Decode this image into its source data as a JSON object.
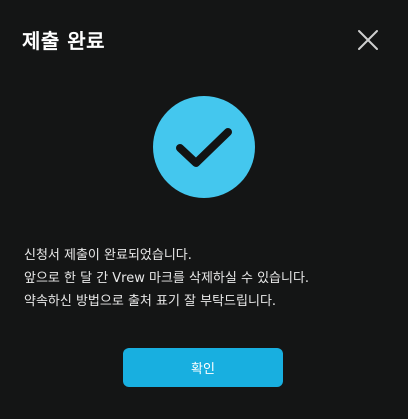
{
  "dialog": {
    "title": "제출 완료",
    "close_icon": "close-icon",
    "status_icon": "check-circle-icon",
    "message_lines": [
      "신청서 제출이 완료되었습니다.",
      "앞으로 한 달 간 Vrew 마크를 삭제하실 수 있습니다.",
      "약속하신 방법으로 출처 표기 잘 부탁드립니다."
    ],
    "confirm_label": "확인"
  },
  "colors": {
    "background": "#141515",
    "accent": "#18afe0",
    "badge": "#44c7ee",
    "text": "#ffffff"
  }
}
